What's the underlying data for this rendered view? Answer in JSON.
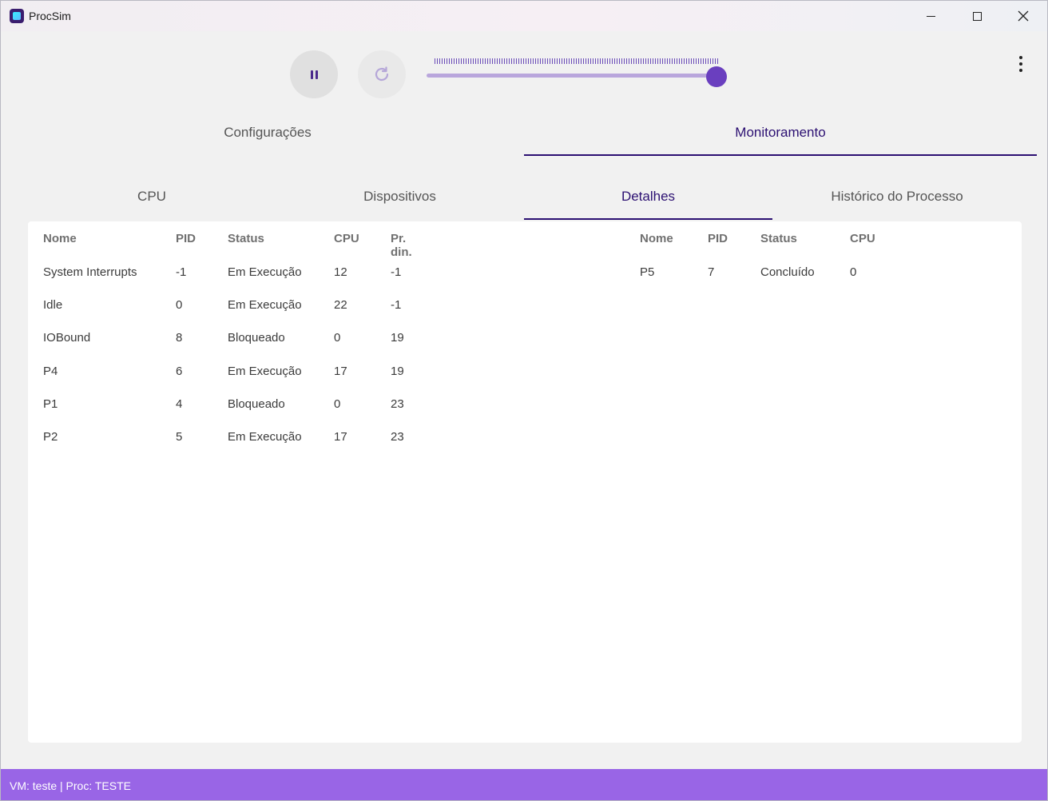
{
  "window": {
    "title": "ProcSim",
    "accent_color": "#2c1072",
    "statusbar_color": "#9965e6"
  },
  "toolbar": {
    "pause_icon": "pause-icon",
    "reload_icon": "reload-icon",
    "speed_slider_value": 0.96,
    "more_icon": "more-vert-icon"
  },
  "top_tabs": [
    {
      "label": "Configurações",
      "active": false
    },
    {
      "label": "Monitoramento",
      "active": true
    }
  ],
  "sub_tabs": [
    {
      "label": "CPU",
      "active": false
    },
    {
      "label": "Dispositivos",
      "active": false
    },
    {
      "label": "Detalhes",
      "active": true
    },
    {
      "label": "Histórico do Processo",
      "active": false
    }
  ],
  "left_table": {
    "headers": [
      "Nome",
      "PID",
      "Status",
      "CPU",
      "Pr. din."
    ],
    "rows": [
      [
        "System Interrupts",
        "-1",
        "Em Execução",
        "12",
        "-1"
      ],
      [
        "Idle",
        "0",
        "Em Execução",
        "22",
        "-1"
      ],
      [
        "IOBound",
        "8",
        "Bloqueado",
        "0",
        "19"
      ],
      [
        "P4",
        "6",
        "Em Execução",
        "17",
        "19"
      ],
      [
        "P1",
        "4",
        "Bloqueado",
        "0",
        "23"
      ],
      [
        "P2",
        "5",
        "Em Execução",
        "17",
        "23"
      ]
    ]
  },
  "right_table": {
    "headers": [
      "Nome",
      "PID",
      "Status",
      "CPU"
    ],
    "rows": [
      [
        "P5",
        "7",
        "Concluído",
        "0"
      ]
    ]
  },
  "statusbar": {
    "text": "VM: teste | Proc: TESTE"
  }
}
